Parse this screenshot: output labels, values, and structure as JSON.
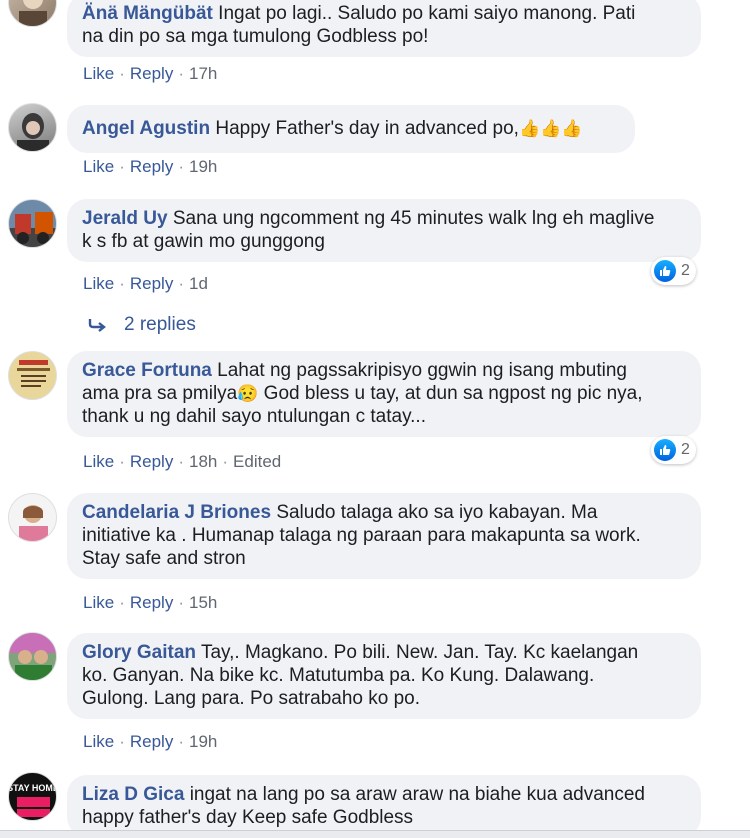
{
  "comments": [
    {
      "author": "Änä Mängübät",
      "text_line1": "Ingat po lagi.. Saludo po kami saiyo manong. Pati",
      "text_line2": "na din po sa mga tumulong Godbless po!",
      "like": "Like",
      "reply": "Reply",
      "time": "17h"
    },
    {
      "author": "Angel Agustin",
      "text_line1": "Happy Father's day in advanced po,",
      "emoji": "👍👍👍",
      "like": "Like",
      "reply": "Reply",
      "time": "19h"
    },
    {
      "author": "Jerald Uy",
      "text_line1": "Sana ung ngcomment ng 45 minutes walk lng eh maglive",
      "text_line2": "k s fb at gawin mo gunggong",
      "like": "Like",
      "reply": "Reply",
      "time": "1d",
      "reaction_count": "2",
      "replies_label": "2 replies"
    },
    {
      "author": "Grace Fortuna",
      "text_line1": "Lahat ng pagssakripisyo ggwin ng isang mbuting",
      "text_line2a": "ama pra sa pmilya",
      "emoji": "😥",
      "text_line2b": " God bless u tay, at dun sa ngpost ng pic nya,",
      "text_line3": "thank u ng dahil sayo ntulungan c tatay...",
      "like": "Like",
      "reply": "Reply",
      "time": "18h",
      "edited": "Edited",
      "reaction_count": "2"
    },
    {
      "author": "Candelaria J Briones",
      "text_line1": "Saludo talaga ako sa iyo kabayan. Ma",
      "text_line2": "initiative ka . Humanap talaga ng paraan para makapunta sa work.",
      "text_line3": "Stay safe and stron",
      "like": "Like",
      "reply": "Reply",
      "time": "15h"
    },
    {
      "author": "Glory Gaitan",
      "text_line1": "Tay,. Magkano. Po bili. New. Jan. Tay. Kc kaelangan",
      "text_line2": "ko. Ganyan. Na bike kc. Matutumba pa. Ko Kung. Dalawang.",
      "text_line3": "Gulong. Lang para. Po satrabaho ko po.",
      "like": "Like",
      "reply": "Reply",
      "time": "19h"
    },
    {
      "author": "Liza D Gica",
      "text_line1": "ingat na lang po sa araw araw na biahe kua advanced",
      "text_line2": "happy father's day Keep safe Godbless",
      "avatar_text": "STAY HOME"
    }
  ],
  "colors": {
    "author": "#385898",
    "bubble": "#f0f2f5",
    "meta": "#616770",
    "like_blue": "#1877f2"
  },
  "icons": {
    "reaction": "like-reaction-icon",
    "replies": "reply-arrow-icon"
  }
}
